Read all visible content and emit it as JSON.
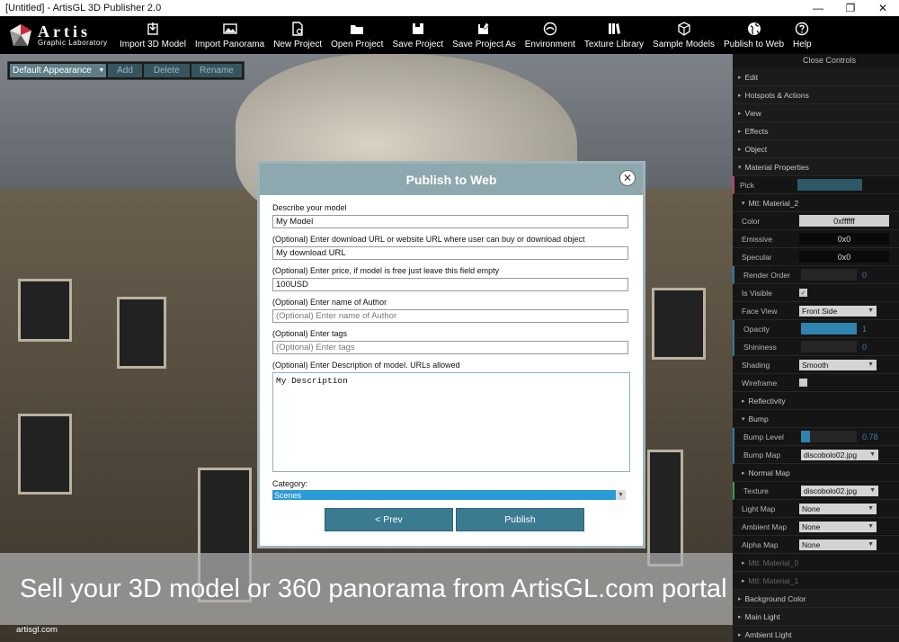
{
  "window": {
    "title": "[Untitled] - ArtisGL 3D Publisher 2.0",
    "minimize": "—",
    "maximize": "❐",
    "close": "✕"
  },
  "logo": {
    "name": "Artis",
    "tagline": "Graphic Laboratory"
  },
  "toolbar": [
    {
      "label": "Import 3D Model",
      "icon": "import-model-icon"
    },
    {
      "label": "Import Panorama",
      "icon": "import-panorama-icon"
    },
    {
      "label": "New Project",
      "icon": "new-project-icon"
    },
    {
      "label": "Open Project",
      "icon": "open-folder-icon"
    },
    {
      "label": "Save Project",
      "icon": "save-icon"
    },
    {
      "label": "Save Project As",
      "icon": "save-as-icon"
    },
    {
      "label": "Environment",
      "icon": "environment-icon"
    },
    {
      "label": "Texture Library",
      "icon": "texture-library-icon"
    },
    {
      "label": "Sample Models",
      "icon": "sample-models-icon"
    },
    {
      "label": "Publish to Web",
      "icon": "globe-icon"
    },
    {
      "label": "Help",
      "icon": "help-icon"
    }
  ],
  "appearance": {
    "selected": "Default Appearance",
    "add": "Add",
    "delete": "Delete",
    "rename": "Rename"
  },
  "panel": {
    "close_controls": "Close Controls",
    "sections": {
      "edit": "Edit",
      "hotspots": "Hotspots & Actions",
      "view": "View",
      "effects": "Effects",
      "object": "Object",
      "material": "Material Properties"
    },
    "pick": "Pick",
    "mtl2": "Mtl: Material_2",
    "color": {
      "label": "Color",
      "value": "0xffffff"
    },
    "emissive": {
      "label": "Emissive",
      "value": "0x0"
    },
    "specular": {
      "label": "Specular",
      "value": "0x0"
    },
    "render_order": {
      "label": "Render Order",
      "value": "0"
    },
    "is_visible": {
      "label": "Is Visible",
      "check": "✓"
    },
    "face_view": {
      "label": "Face View",
      "value": "Front Side"
    },
    "opacity": {
      "label": "Opacity",
      "value": "1",
      "level": 1
    },
    "shininess": {
      "label": "Shininess",
      "value": "0",
      "level": 0
    },
    "shading": {
      "label": "Shading",
      "value": "Smooth"
    },
    "wireframe": {
      "label": "Wireframe"
    },
    "reflectivity": "Reflectivity",
    "bump": "Bump",
    "bump_level": {
      "label": "Bump Level",
      "value": "0.78",
      "level": 0.78
    },
    "bump_map": {
      "label": "Bump Map",
      "value": "discobolo02.jpg"
    },
    "normal_map": "Normal Map",
    "texture": {
      "label": "Texture",
      "value": "discobolo02.jpg"
    },
    "light_map": {
      "label": "Light Map",
      "value": "None"
    },
    "ambient_map": {
      "label": "Ambient Map",
      "value": "None"
    },
    "alpha_map": {
      "label": "Alpha Map",
      "value": "None"
    },
    "mtl0": "Mtl: Material_0",
    "mtl1": "Mtl: Material_1",
    "background_color": "Background Color",
    "main_light": "Main Light",
    "ambient_light": "Ambient Light"
  },
  "modal": {
    "title": "Publish to Web",
    "close": "✕",
    "fields": {
      "describe_label": "Describe your model",
      "describe_value": "My Model",
      "url_label": "(Optional) Enter download URL or website URL where user can buy or download object",
      "url_value": "My download URL",
      "price_label": "(Optional) Enter price, if model is free just leave this field empty",
      "price_value": "100USD",
      "author_label": "(Optional) Enter name of Author",
      "author_placeholder": "(Optional) Enter name of Author",
      "tags_label": "(Optional) Enter tags",
      "tags_placeholder": "(Optional) Enter tags",
      "desc_label": "(Optional) Enter Description of model. URLs allowed",
      "desc_value": "My Description",
      "category_label": "Category:",
      "category_value": "Scenes"
    },
    "prev": "< Prev",
    "publish": "Publish"
  },
  "banner": "Sell your 3D model or 360 panorama from ArtisGL.com portal",
  "footer": "artisgl.com"
}
